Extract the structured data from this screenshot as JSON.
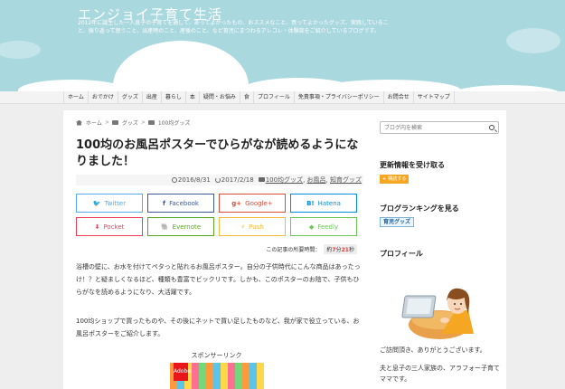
{
  "header": {
    "site_title": "エンジョイ子育て生活",
    "site_description": "2012年に誕生した一人息子の子育てを通して、あってよかったもの、おススメなこと、買ってよかったグッズ、実践していること、振り返って思うこと、出産時のこと、産後のこと、など育児にまつわるアレコレ・体験談をご紹介しているブログです。"
  },
  "nav": {
    "items": [
      "ホーム",
      "おでかけ",
      "グッズ",
      "出産",
      "暮らし",
      "本",
      "疑問・お悩み",
      "食",
      "プロフィール",
      "免責事項・プライバシーポリシー",
      "お問合せ",
      "サイトマップ"
    ]
  },
  "breadcrumb": {
    "items": [
      "ホーム",
      "グッズ",
      "100均グッズ"
    ],
    "separator": ">"
  },
  "article": {
    "title": "100均のお風呂ポスターでひらがなが読めるようになりました！",
    "published": "2016/8/31",
    "updated": "2017/2/18",
    "categories": [
      "100均グッズ",
      "お風呂",
      "知育グッズ"
    ],
    "category_separator": ",",
    "read_time_label": "この記事の所要時間：",
    "read_time_prefix": "約",
    "read_time_minutes": "7",
    "read_time_min_unit": "分",
    "read_time_seconds": "21",
    "read_time_sec_unit": "秒",
    "paragraphs": [
      "浴槽の壁に、お水を付けてペタっと貼れるお風呂ポスター。自分の子供時代にこんな商品はあったっけ！？と疑ましくなるほど、種類も豊富でビックリです。しかも、このポスターのお陰で、子供もひらがなを読めるようになり、大活躍です。",
      "100均ショップで買ったものや、その後にネットで買い足したものなど、我が家で役立っている、お風呂ポスターをご紹介します。"
    ],
    "sponsor_label": "スポンサーリンク",
    "ad_logo_text": "Adobe"
  },
  "share": {
    "buttons": [
      {
        "name": "twitter",
        "icon": "🐦",
        "label": "Twitter",
        "color": "#55acee"
      },
      {
        "name": "facebook",
        "icon": "f",
        "label": "Facebook",
        "color": "#3b5998"
      },
      {
        "name": "googleplus",
        "icon": "g+",
        "label": "Google+",
        "color": "#dd4b39"
      },
      {
        "name": "hatena",
        "icon": "B!",
        "label": "Hatena",
        "color": "#008fde"
      },
      {
        "name": "pocket",
        "icon": "⬇",
        "label": "Pocket",
        "color": "#ef3f56"
      },
      {
        "name": "evernote",
        "icon": "🐘",
        "label": "Evernote",
        "color": "#5ba525"
      },
      {
        "name": "push",
        "icon": "⚡",
        "label": "Push",
        "color": "#f6b93b"
      },
      {
        "name": "feedly",
        "icon": "◆",
        "label": "Feedly",
        "color": "#6cc655"
      }
    ]
  },
  "sidebar": {
    "search_placeholder": "ブログ内を検索",
    "follow_title": "更新情報を受け取る",
    "follow_plus": "+",
    "follow_label": "購読する",
    "ranking_title": "ブログランキングを見る",
    "ranking_badge": "育児グッズ",
    "profile_title": "プロフィール",
    "profile_greeting": "ご訪問頂き、ありがとうございます。",
    "profile_text": "夫と息子の三人家族の、アラフォー子育てママです。"
  },
  "colors": {
    "header_bg": "#a9d8df",
    "page_bg": "#eeeeee",
    "follow_badge": "#f5a623",
    "read_time_number": "#ee3333"
  }
}
